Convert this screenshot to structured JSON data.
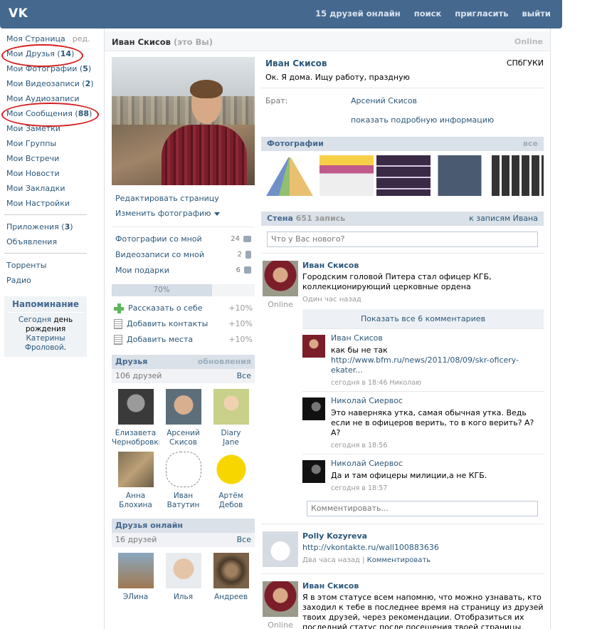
{
  "header": {
    "logo": "VK",
    "nav": [
      "15 друзей онлайн",
      "поиск",
      "пригласить",
      "выйти"
    ]
  },
  "leftmenu": {
    "my_page": "Моя Страница",
    "edit": "ред.",
    "friends": "Мои Друзья",
    "friends_count": "14",
    "photos": "Мои Фотографии",
    "photos_count": "5",
    "videos": "Мои Видеозаписи",
    "videos_count": "2",
    "audio": "Мои Аудиозаписи",
    "messages": "Мои Сообщения",
    "messages_count": "88",
    "notes": "Мои Заметки",
    "groups": "Мои Группы",
    "events": "Мои Встречи",
    "news": "Мои Новости",
    "bookmarks": "Мои Закладки",
    "settings": "Мои Настройки",
    "apps": "Приложения",
    "apps_count": "3",
    "ads": "Объявления",
    "torrents": "Торренты",
    "radio": "Радио"
  },
  "reminder": {
    "title": "Напоминание",
    "today": "Сегодня",
    "day": "день",
    "birthday": "рождения",
    "who1": "Катерины",
    "who2": "Фроловой",
    "dot": "."
  },
  "titlebar": {
    "name": "Иван Скисов",
    "you": "(это Вы)",
    "online": "Online"
  },
  "profile_actions": {
    "edit_page": "Редактировать страницу",
    "change_photo": "Изменить фотографию",
    "photos_with_me": "Фотографии со мной",
    "photos_with_me_count": "24",
    "videos_with_me": "Видеозаписи со мной",
    "videos_with_me_count": "2",
    "gifts": "Мои подарки",
    "gifts_count": "6"
  },
  "completion": {
    "percent_label": "70%",
    "percent": 70,
    "tasks": [
      {
        "label": "Рассказать о себе",
        "pct": "+10%"
      },
      {
        "label": "Добавить контакты",
        "pct": "+10%"
      },
      {
        "label": "Добавить места",
        "pct": "+10%"
      }
    ]
  },
  "friends_block": {
    "title": "Друзья",
    "updates": "обновления",
    "count": "106 друзей",
    "all": "Все",
    "list": [
      {
        "first": "Елизавета",
        "last": "Чернобровкин"
      },
      {
        "first": "Арсений",
        "last": "Скисов"
      },
      {
        "first": "Diary",
        "last": "Jane"
      },
      {
        "first": "Анна",
        "last": "Блохина"
      },
      {
        "first": "Иван",
        "last": "Ватутин"
      },
      {
        "first": "Артём",
        "last": "Дебов"
      }
    ]
  },
  "online_block": {
    "title": "Друзья онлайн",
    "count": "16 друзей",
    "all": "Все",
    "list": [
      {
        "first": "ЭЛина"
      },
      {
        "first": "Илья"
      },
      {
        "first": "Андреев"
      }
    ]
  },
  "profile": {
    "name": "Иван Скисов",
    "university": "СПбГУКИ",
    "status": "Ок. Я дома. Ищу работу, праздную",
    "brother_label": "Брат:",
    "brother": "Арсений Скисов",
    "more": "показать подробную информацию"
  },
  "photos_section": {
    "title": "Фотографии",
    "all": "все"
  },
  "wall": {
    "title": "Стена",
    "count": "651 запись",
    "to_posts": "к записям Ивана",
    "placeholder": "Что у Вас нового?",
    "post1": {
      "author": "Иван Скисов",
      "text": "Городским головой Питера стал офицер КГБ, коллекционирующий церковные ордена",
      "date": "Один час назад",
      "online": "Online",
      "show_all": "Показать все 6 комментариев"
    },
    "replies": [
      {
        "author": "Иван Скисов",
        "text": "как бы не так ",
        "link": "http://www.bfm.ru/news/2011/08/09/skr-oficery-ekater...",
        "date": "сегодня в 18:46",
        "to": "Николаю"
      },
      {
        "author": "Николай Сиервос",
        "text": "Это наверняка утка, самая обычная утка. Ведь если не в офицеров верить, то в кого верить? А? А?",
        "date": "сегодня в 18:56"
      },
      {
        "author": "Николай Сиервос",
        "text": "Да и там офицеры милиции,а не КГБ.",
        "date": "сегодня в 18:57"
      }
    ],
    "comment_placeholder": "Комментировать...",
    "post2": {
      "author": "Polly Kozyreva",
      "link": "http://vkontakte.ru/wall100883636",
      "date": "Два часа назад",
      "sep": "|",
      "comment": "Комментировать"
    },
    "post3": {
      "author": "Иван Скисов",
      "text": "Я в этом статусе всем напомню, что можно узнавать, кто заходил к тебе в последнее время на страницу из друзей твоих друзей, через рекомендации. Отобразиться их последний статус после посещения твоей страницы. Очень удобно и захватывающе",
      "online": "Online"
    }
  },
  "colors": {
    "header": "#45688e",
    "link": "#2b587a",
    "annotation": "#d42020"
  }
}
